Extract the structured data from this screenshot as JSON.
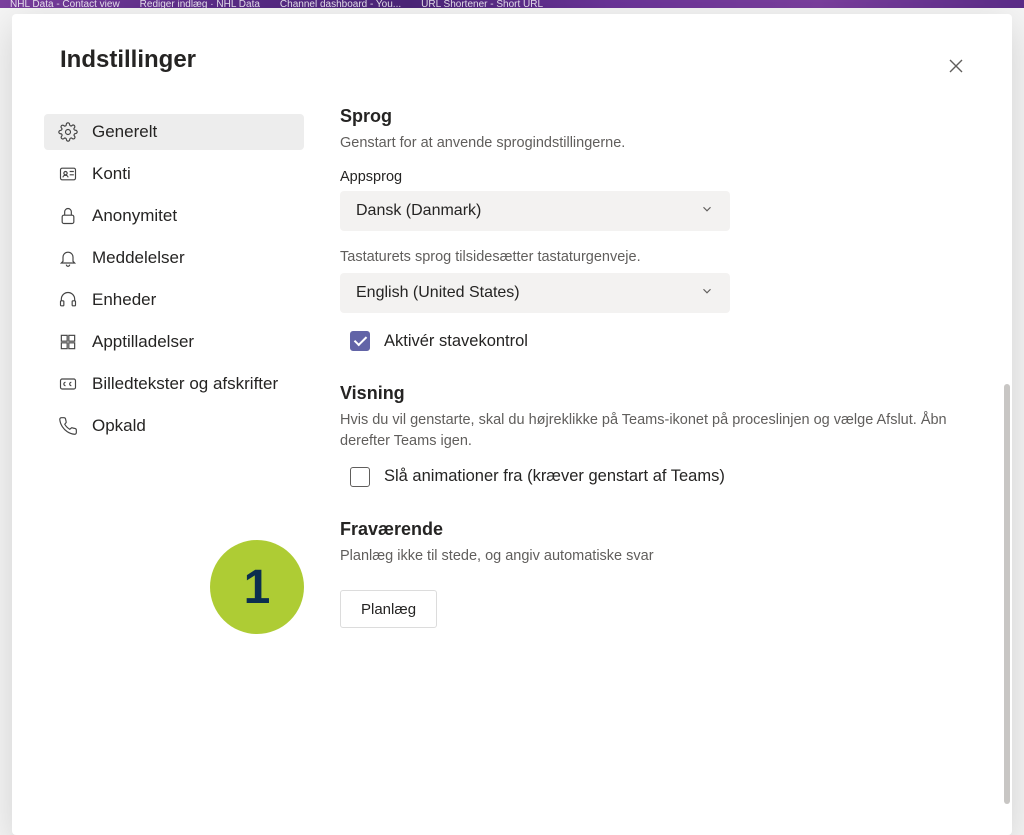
{
  "browserTabs": [
    "NHL Data - Contact view",
    "Rediger indlæg · NHL Data",
    "Channel dashboard - You...",
    "URL Shortener - Short URL"
  ],
  "modal": {
    "title": "Indstillinger"
  },
  "sidebar": {
    "items": [
      {
        "label": "Generelt"
      },
      {
        "label": "Konti"
      },
      {
        "label": "Anonymitet"
      },
      {
        "label": "Meddelelser"
      },
      {
        "label": "Enheder"
      },
      {
        "label": "Apptilladelser"
      },
      {
        "label": "Billedtekster og afskrifter"
      },
      {
        "label": "Opkald"
      }
    ]
  },
  "sections": {
    "lang": {
      "title": "Sprog",
      "desc": "Genstart for at anvende sprogindstillingerne.",
      "appLangLabel": "Appsprog",
      "appLangValue": "Dansk (Danmark)",
      "keyboardHint": "Tastaturets sprog tilsidesætter tastaturgenveje.",
      "keyboardValue": "English (United States)",
      "spellcheckLabel": "Aktivér stavekontrol"
    },
    "display": {
      "title": "Visning",
      "desc": "Hvis du vil genstarte, skal du højreklikke på Teams-ikonet på proceslinjen og vælge Afslut. Åbn derefter Teams igen.",
      "animLabel": "Slå animationer fra (kræver genstart af Teams)"
    },
    "away": {
      "title": "Fraværende",
      "desc": "Planlæg ikke til stede, og angiv automatiske svar",
      "btn": "Planlæg"
    }
  },
  "annotation": {
    "num": "1"
  }
}
